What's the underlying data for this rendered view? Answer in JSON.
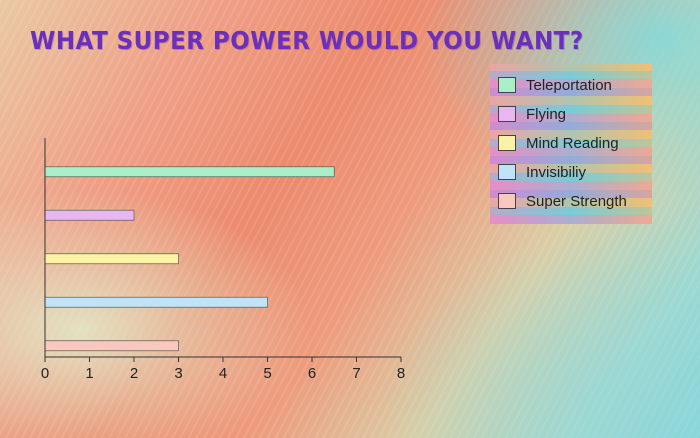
{
  "chart_data": {
    "type": "bar",
    "orientation": "horizontal",
    "title": "What Super Power Would You Want?",
    "categories": [
      "Teleportation",
      "Flying",
      "Mind Reading",
      "Invisibiliy",
      "Super Strength"
    ],
    "values": [
      6.5,
      2,
      3,
      5,
      3
    ],
    "colors": [
      "#a8efc8",
      "#eab6f2",
      "#fbf2a6",
      "#bfe4f7",
      "#f8c8be"
    ],
    "xlim": [
      0,
      8
    ],
    "xticks": [
      "0",
      "1",
      "2",
      "3",
      "4",
      "5",
      "6",
      "7",
      "8"
    ],
    "xlabel": "",
    "ylabel": "",
    "grid": false,
    "legend_position": "top-right"
  },
  "title_color": "#6a2fbf"
}
